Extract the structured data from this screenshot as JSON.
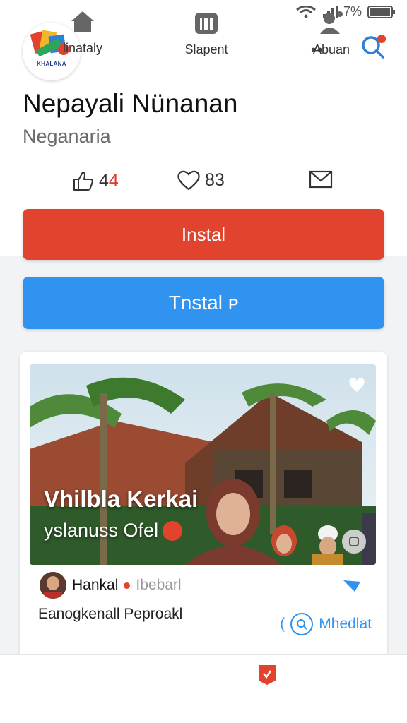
{
  "status_bar": {
    "battery_label": "7%"
  },
  "header": {
    "logo_text": "KHALANA",
    "title": "Nepayali Nünanan",
    "subtitle": "Neganaria"
  },
  "stats": {
    "likes_prefix": "4",
    "likes_suffix": "4",
    "hearts": "83"
  },
  "buttons": {
    "primary_label": "Instal",
    "secondary_label": "Tnstal ᴘ"
  },
  "card": {
    "hero_title": "Vhilbla Kerkai",
    "hero_subtitle": "yslanuss Ofel",
    "author_name": "Hankal",
    "author_secondary": "Ibebarl",
    "description": "Eanogkenall Peproakl",
    "action_label": "Mhedlat"
  },
  "tabbar": {
    "items": [
      {
        "label": "linataly"
      },
      {
        "label": "Slapent"
      },
      {
        "label": "Abuan"
      }
    ]
  },
  "colors": {
    "primary_red": "#e2432f",
    "primary_blue": "#2f93ef"
  }
}
